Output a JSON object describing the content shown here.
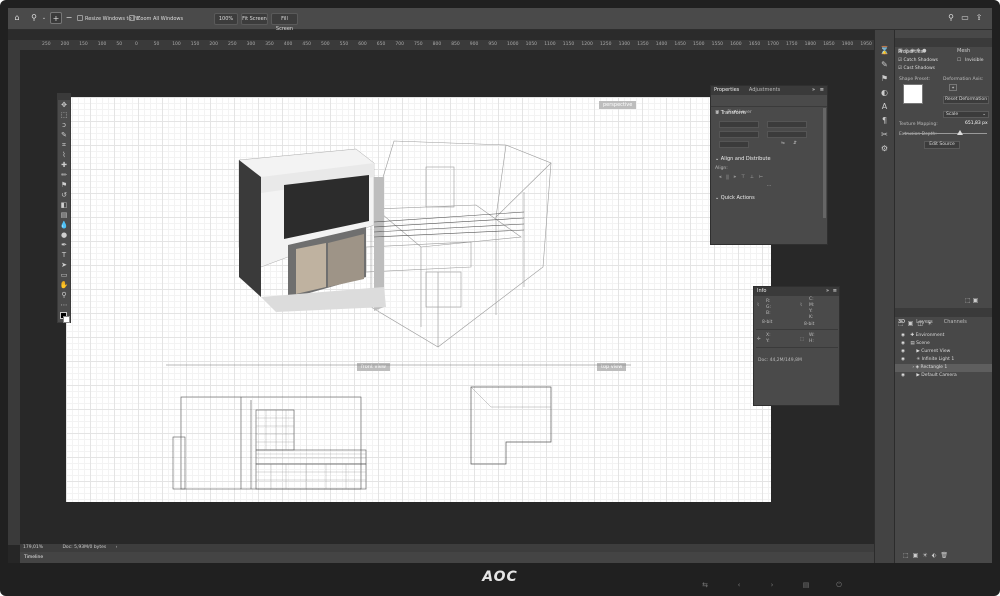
{
  "options_bar": {
    "resize_windows_label": "Resize Windows to Fit",
    "zoom_all_windows_label": "Zoom All Windows",
    "zoom_100_label": "100%",
    "fit_screen_label": "Fit Screen",
    "fill_screen_label": "Fill Screen"
  },
  "ruler_ticks": [
    "250",
    "200",
    "150",
    "100",
    "50",
    "0",
    "50",
    "100",
    "150",
    "200",
    "250",
    "300",
    "350",
    "400",
    "450",
    "500",
    "550",
    "600",
    "650",
    "700",
    "750",
    "800",
    "850",
    "900",
    "950",
    "1000",
    "1050",
    "1100",
    "1150",
    "1200",
    "1250",
    "1300",
    "1350",
    "1400",
    "1450",
    "1500",
    "1550",
    "1600",
    "1650",
    "1700",
    "1750",
    "1800",
    "1850",
    "1900",
    "1950"
  ],
  "artboard": {
    "perspective_label": "perspective",
    "front_view_label": "front view",
    "top_view_label": "top view"
  },
  "properties_panel": {
    "tab_properties": "Properties",
    "tab_adjustments": "Adjustments",
    "layer_type": "Pixel Layer",
    "transform_title": "Transform",
    "align_title": "Align and Distribute",
    "align_label": "Align:",
    "quick_actions_title": "Quick Actions"
  },
  "info_panel": {
    "title": "Info",
    "r_label": "R:",
    "g_label": "G:",
    "b_label": "B:",
    "c_label": "C:",
    "m_label": "M:",
    "y_label": "Y:",
    "k_label": "K:",
    "bit_left": "8-bit",
    "bit_right": "8-bit",
    "x_label": "X:",
    "y_coord_label": "Y:",
    "w_label": "W:",
    "h_label": "H:",
    "doc_info": "Doc: 44,2M/149,8M"
  },
  "dock_properties": {
    "title": "Properties",
    "mesh_label": "Mesh",
    "catch_shadows": "Catch Shadows",
    "invisible": "Invisible",
    "cast_shadows": "Cast Shadows",
    "shape_preset": "Shape Preset:",
    "deformation_axis": "Deformation Axis:",
    "reset_deformation": "Reset Deformation",
    "texture_mapping_label": "Texture Mapping:",
    "texture_mapping_value": "Scale",
    "extrusion_depth_label": "Extrusion Depth:",
    "extrusion_depth_value": "651,83 px",
    "edit_source": "Edit Source"
  },
  "dock_3d": {
    "tab_3d": "3D",
    "tab_layers": "Layers",
    "tab_channels": "Channels",
    "items": [
      "Environment",
      "Scene",
      "Current View",
      "Infinite Light 1",
      "Rectangle 1",
      "Default Camera"
    ]
  },
  "status_bar": {
    "zoom": "179,01%",
    "doc": "Doc: 5,93M/0 bytes"
  },
  "timeline_label": "Timeline",
  "monitor_brand": "AOC"
}
